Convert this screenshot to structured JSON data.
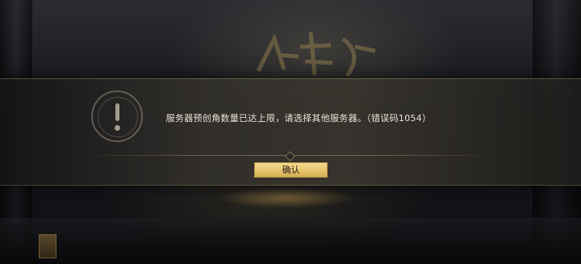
{
  "dialog": {
    "icon": "exclamation-icon",
    "message": "服务器预创角数量已达上限，请选择其他服务器。（错误码1054）",
    "confirm_label": "确认"
  },
  "colors": {
    "accent_button": "#e6c46d",
    "message_text": "#e9e3d6"
  }
}
